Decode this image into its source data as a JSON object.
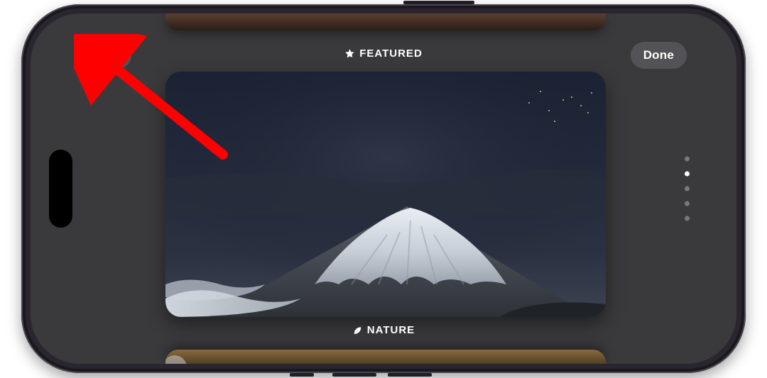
{
  "header": {
    "add_glyph": "+",
    "done_label": "Done"
  },
  "categories": {
    "top": "FEATURED",
    "bottom": "NATURE"
  },
  "pager": {
    "count": 5,
    "active_index": 1
  },
  "colors": {
    "annotation": "#ff0000",
    "screen_bg": "#3a3a3c"
  }
}
